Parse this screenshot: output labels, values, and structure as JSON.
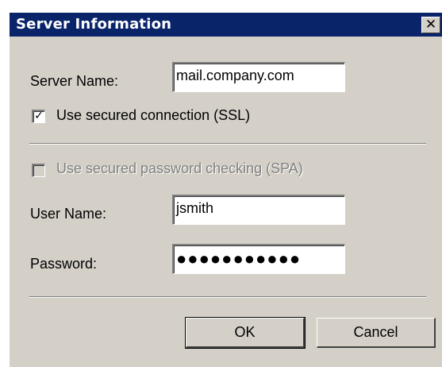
{
  "window": {
    "title": "Server Information",
    "close_glyph": "✕",
    "close_icon": "close-icon"
  },
  "fields": {
    "server_name_label": "Server Name:",
    "server_name_value": "mail.company.com",
    "ssl_label": "Use secured connection (SSL)",
    "ssl_checked": true,
    "spa_label": "Use secured password checking (SPA)",
    "spa_checked": false,
    "spa_enabled": false,
    "user_name_label": "User Name:",
    "user_name_value": "jsmith",
    "password_label": "Password:",
    "password_value": "●●●●●●●●●●●"
  },
  "buttons": {
    "ok": "OK",
    "cancel": "Cancel"
  },
  "colors": {
    "titlebar": "#0a246a",
    "dialog_bg": "#d4d0c8"
  }
}
